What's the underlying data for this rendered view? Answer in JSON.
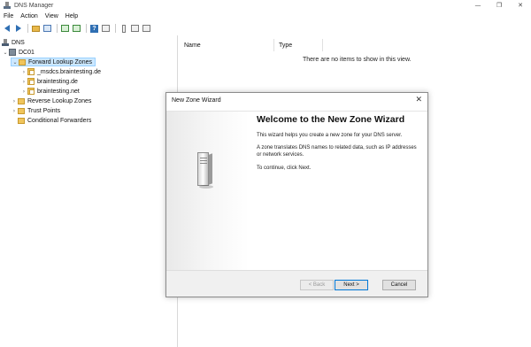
{
  "window": {
    "title": "DNS Manager",
    "controls": {
      "minimize": "—",
      "restore": "❐",
      "close": "✕"
    }
  },
  "menu": {
    "items": [
      "File",
      "Action",
      "View",
      "Help"
    ]
  },
  "toolbar": {
    "icons": [
      "back-arrow-icon",
      "forward-arrow-icon",
      "up-folder-icon",
      "show-pane-icon",
      "refresh-icon",
      "export-icon",
      "help-icon",
      "grid-view-icon",
      "bar-icon",
      "list-icon",
      "details-icon"
    ],
    "help_glyph": "?"
  },
  "tree": {
    "root": "DNS",
    "server": "DC01",
    "forward_zones": "Forward Lookup Zones",
    "zones": [
      "_msdcs.braintesting.de",
      "braintesting.de",
      "braintesting.net"
    ],
    "reverse_zones": "Reverse Lookup Zones",
    "trust_points": "Trust Points",
    "conditional_forwarders": "Conditional Forwarders"
  },
  "list": {
    "columns": [
      "Name",
      "Type"
    ],
    "empty_message": "There are no items to show in this view."
  },
  "wizard": {
    "title": "New Zone Wizard",
    "close_glyph": "✕",
    "heading": "Welcome to the New Zone Wizard",
    "paragraphs": [
      "This wizard helps you create a new zone for your DNS server.",
      "A zone translates DNS names to related data, such as IP addresses or network services.",
      "To continue, click Next."
    ],
    "buttons": {
      "back": "< Back",
      "next": "Next >",
      "cancel": "Cancel"
    }
  },
  "colors": {
    "selection": "#cce8ff",
    "accent": "#0078d7",
    "folder": "#f0c55c"
  }
}
